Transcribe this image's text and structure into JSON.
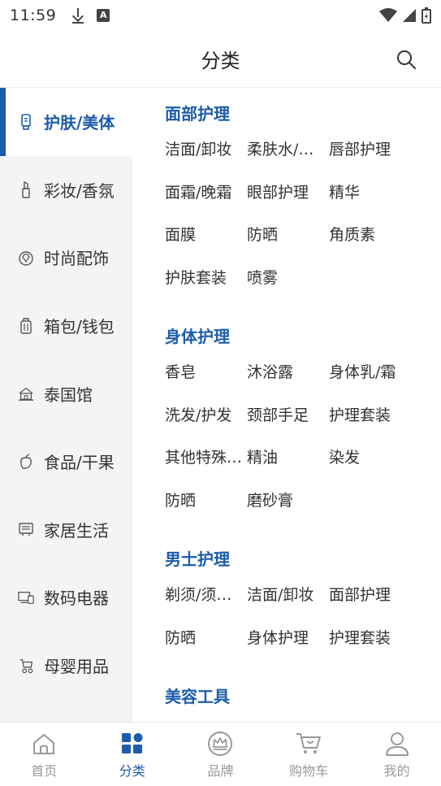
{
  "status_bar": {
    "time": "11:59"
  },
  "header": {
    "title": "分类"
  },
  "sidebar": {
    "items": [
      {
        "label": "护肤/美体",
        "icon": "skincare-tube-icon",
        "active": true
      },
      {
        "label": "彩妆/香氛",
        "icon": "lipstick-icon",
        "active": false
      },
      {
        "label": "时尚配饰",
        "icon": "diamond-ring-icon",
        "active": false
      },
      {
        "label": "箱包/钱包",
        "icon": "luggage-icon",
        "active": false
      },
      {
        "label": "泰国馆",
        "icon": "temple-icon",
        "active": false
      },
      {
        "label": "食品/干果",
        "icon": "fruit-icon",
        "active": false
      },
      {
        "label": "家居生活",
        "icon": "home-appliance-icon",
        "active": false
      },
      {
        "label": "数码电器",
        "icon": "devices-icon",
        "active": false
      },
      {
        "label": "母婴用品",
        "icon": "stroller-icon",
        "active": false
      }
    ]
  },
  "sections": [
    {
      "title": "面部护理",
      "items": [
        "洁面/卸妆",
        "柔肤水/乳液",
        "唇部护理",
        "面霜/晚霜",
        "眼部护理",
        "精华",
        "面膜",
        "防晒",
        "角质素",
        "护肤套装",
        "喷雾"
      ]
    },
    {
      "title": "身体护理",
      "items": [
        "香皂",
        "沐浴露",
        "身体乳/霜",
        "洗发/护发",
        "颈部手足",
        "护理套装",
        "其他特殊护理",
        "精油",
        "染发",
        "防晒",
        "磨砂膏"
      ]
    },
    {
      "title": "男士护理",
      "items": [
        "剃须/须后护理",
        "洁面/卸妆",
        "面部护理",
        "防晒",
        "身体护理",
        "护理套装"
      ]
    },
    {
      "title": "美容工具",
      "items": []
    }
  ],
  "bottom_nav": {
    "items": [
      {
        "label": "首页",
        "icon": "home-icon",
        "active": false
      },
      {
        "label": "分类",
        "icon": "category-grid-icon",
        "active": true
      },
      {
        "label": "品牌",
        "icon": "crown-icon",
        "active": false
      },
      {
        "label": "购物车",
        "icon": "cart-icon",
        "active": false
      },
      {
        "label": "我的",
        "icon": "user-icon",
        "active": false
      }
    ]
  },
  "colors": {
    "accent": "#1d5cab",
    "muted": "#999999",
    "sidebar_bg": "#f4f4f4"
  }
}
